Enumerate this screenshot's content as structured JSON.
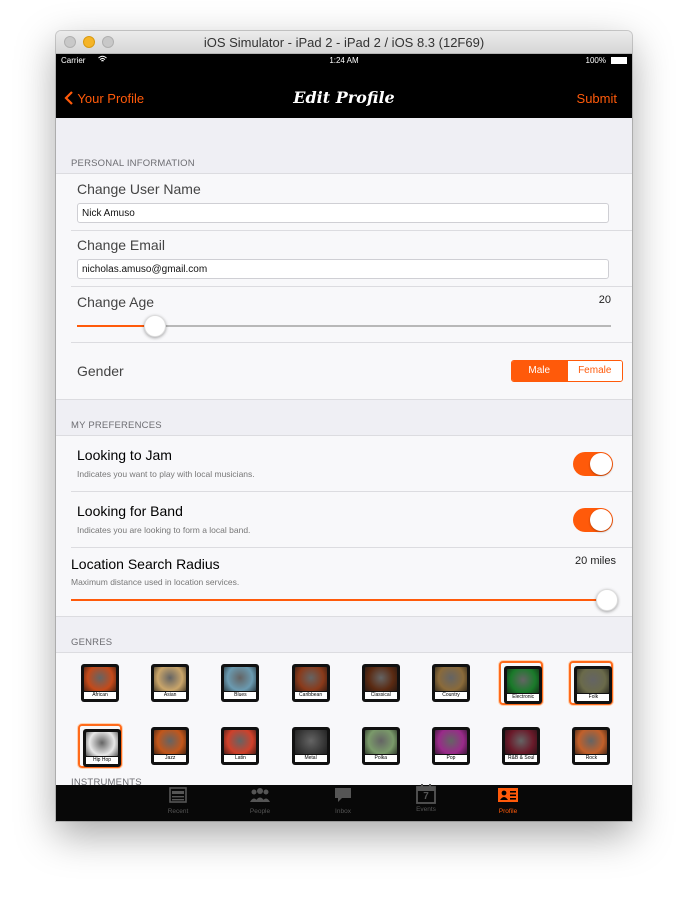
{
  "window": {
    "title": "iOS Simulator - iPad 2 - iPad 2 / iOS 8.3 (12F69)"
  },
  "statusbar": {
    "carrier": "Carrier",
    "time": "1:24 AM",
    "battery": "100%"
  },
  "navbar": {
    "back_label": "Your Profile",
    "title": "Edit Profile",
    "submit_label": "Submit"
  },
  "personal": {
    "header": "PERSONAL INFORMATION",
    "username_label": "Change User Name",
    "username_value": "Nick Amuso",
    "email_label": "Change Email",
    "email_value": "nicholas.amuso@gmail.com",
    "age_label": "Change Age",
    "age_value": "20",
    "age_slider_fraction": 0.13,
    "gender_label": "Gender",
    "gender_options": [
      "Male",
      "Female"
    ],
    "gender_selected": "Male"
  },
  "preferences": {
    "header": "MY PREFERENCES",
    "jam_label": "Looking to Jam",
    "jam_desc": "Indicates you want to play with local musicians.",
    "jam_on": true,
    "band_label": "Looking for Band",
    "band_desc": "Indicates you are looking to form a local band.",
    "band_on": true,
    "radius_label": "Location Search Radius",
    "radius_desc": "Maximum distance used in location services.",
    "radius_value": "20 miles",
    "radius_slider_fraction": 1.0
  },
  "genres": {
    "header": "GENRES",
    "items": [
      {
        "name": "African",
        "selected": false,
        "color": "#c44a1a"
      },
      {
        "name": "Asian",
        "selected": false,
        "color": "#c9a56a"
      },
      {
        "name": "Blues",
        "selected": false,
        "color": "#6a9ab0"
      },
      {
        "name": "Caribbean",
        "selected": false,
        "color": "#8a3a1a"
      },
      {
        "name": "Classical",
        "selected": false,
        "color": "#5a2a12"
      },
      {
        "name": "Country",
        "selected": false,
        "color": "#8a6a3a"
      },
      {
        "name": "Electronic",
        "selected": true,
        "color": "#1a7a2a"
      },
      {
        "name": "Folk",
        "selected": true,
        "color": "#6a6a4a"
      },
      {
        "name": "Hip Hop",
        "selected": true,
        "color": "#e8e8e8"
      },
      {
        "name": "Jazz",
        "selected": false,
        "color": "#c2561a"
      },
      {
        "name": "Latin",
        "selected": false,
        "color": "#d0402a"
      },
      {
        "name": "Metal",
        "selected": false,
        "color": "#3a3a3a"
      },
      {
        "name": "Polka",
        "selected": false,
        "color": "#7a9a6a"
      },
      {
        "name": "Pop",
        "selected": false,
        "color": "#9a2a8a"
      },
      {
        "name": "R&B & Soul",
        "selected": false,
        "color": "#6a1a2a"
      },
      {
        "name": "Rock",
        "selected": false,
        "color": "#c2602a"
      }
    ]
  },
  "instruments": {
    "header": "INSTRUMENTS"
  },
  "tabbar": {
    "items": [
      {
        "label": "Recent",
        "icon": "newspaper-icon",
        "active": false
      },
      {
        "label": "People",
        "icon": "people-icon",
        "active": false
      },
      {
        "label": "Inbox",
        "icon": "chat-bubble-icon",
        "active": false
      },
      {
        "label": "Events",
        "icon": "calendar-icon",
        "calendar_day": "7",
        "active": false
      },
      {
        "label": "Profile",
        "icon": "profile-card-icon",
        "active": true
      }
    ]
  },
  "colors": {
    "accent": "#ff5a0a",
    "background": "#efeff4",
    "bar": "#000000"
  }
}
